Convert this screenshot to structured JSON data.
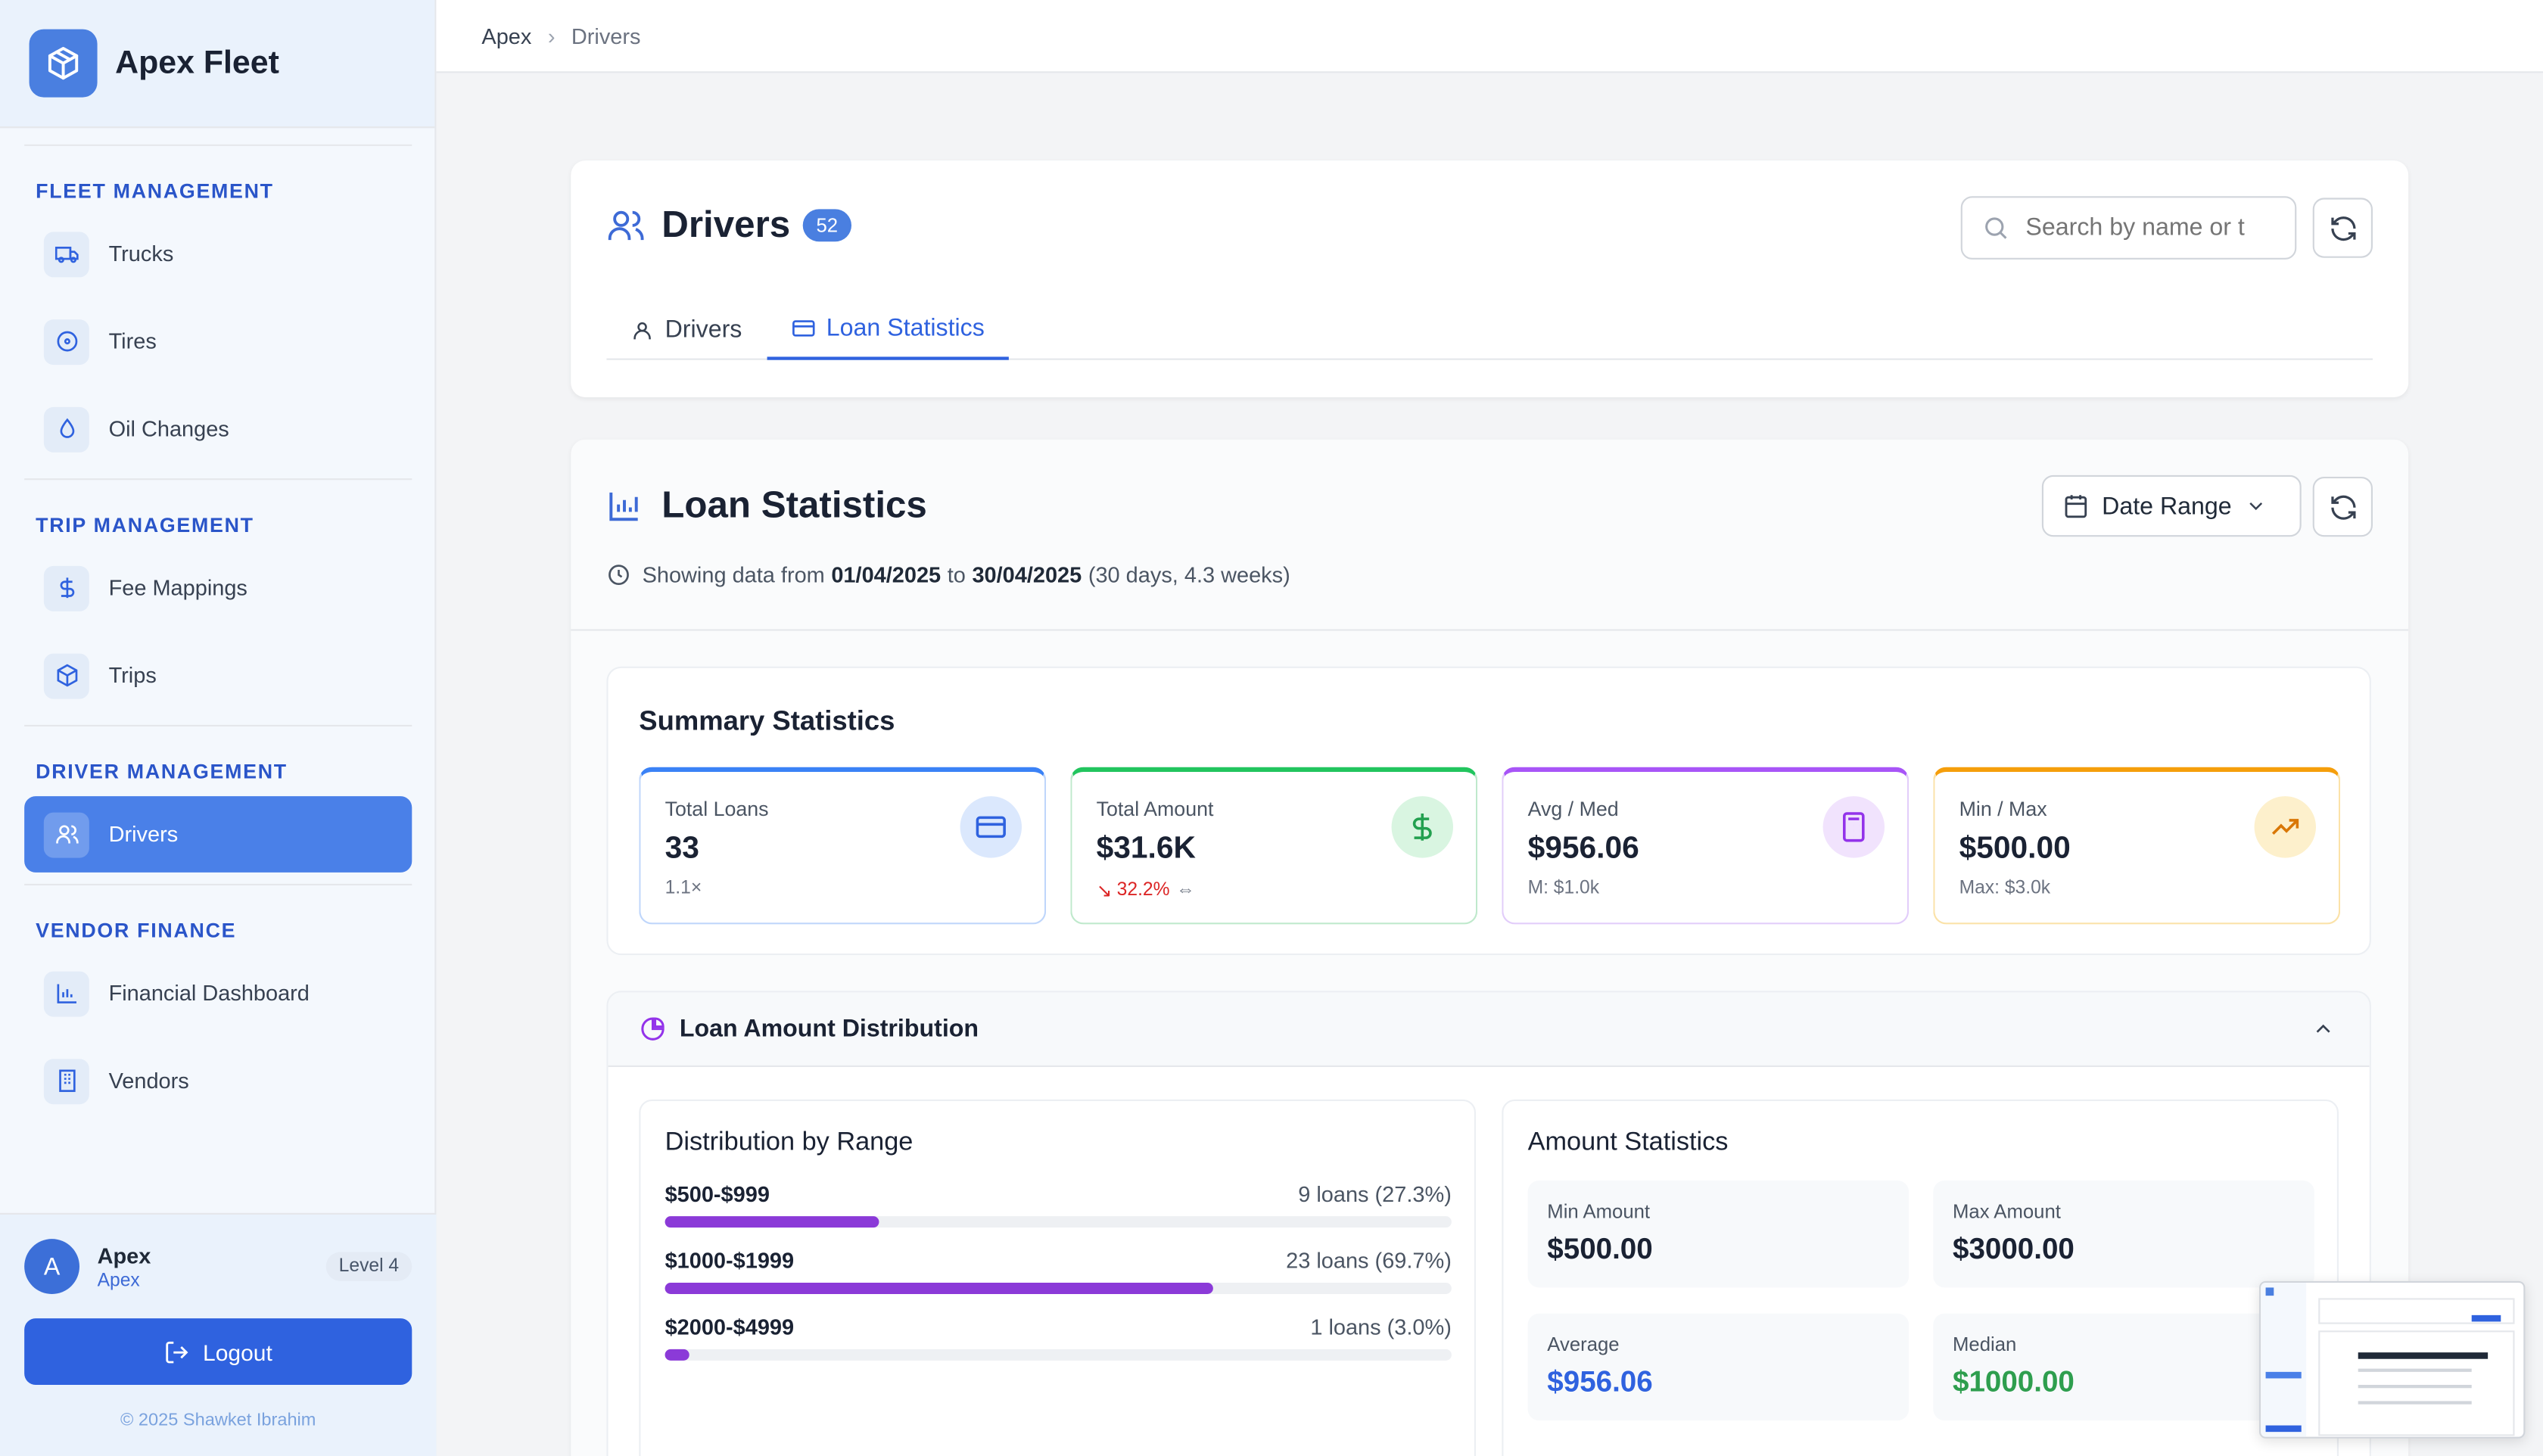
{
  "brand": {
    "name": "Apex Fleet"
  },
  "sidebar": {
    "sections": [
      {
        "title": "FLEET MANAGEMENT",
        "items": [
          "Trucks",
          "Tires",
          "Oil Changes"
        ]
      },
      {
        "title": "TRIP MANAGEMENT",
        "items": [
          "Fee Mappings",
          "Trips"
        ]
      },
      {
        "title": "DRIVER MANAGEMENT",
        "items": [
          "Drivers"
        ]
      },
      {
        "title": "VENDOR FINANCE",
        "items": [
          "Financial Dashboard",
          "Vendors"
        ]
      }
    ],
    "active_item": "Drivers"
  },
  "user": {
    "initial": "A",
    "name": "Apex",
    "org": "Apex",
    "level": "Level 4",
    "logout_label": "Logout",
    "copyright": "© 2025 Shawket Ibrahim"
  },
  "breadcrumb": {
    "root": "Apex",
    "current": "Drivers"
  },
  "header": {
    "title": "Drivers",
    "count": "52",
    "search_placeholder": "Search by name or t",
    "tabs": [
      "Drivers",
      "Loan Statistics"
    ],
    "active_tab": "Loan Statistics"
  },
  "loan_stats": {
    "title": "Loan Statistics",
    "date_button": "Date Range",
    "range_prefix": "Showing data from",
    "range_start": "01/04/2025",
    "range_to": "to",
    "range_end": "30/04/2025",
    "range_suffix": "(30 days, 4.3 weeks)",
    "summary_title": "Summary Statistics",
    "cards": [
      {
        "label": "Total Loans",
        "value": "33",
        "sub": "1.1×",
        "color": "#3b82f6"
      },
      {
        "label": "Total Amount",
        "value": "$31.6K",
        "sub": "32.2%",
        "color": "#22c55e"
      },
      {
        "label": "Avg / Med",
        "value": "$956.06",
        "sub": "M: $1.0k",
        "color": "#a855f7"
      },
      {
        "label": "Min / Max",
        "value": "$500.00",
        "sub": "Max: $3.0k",
        "color": "#f59e0b"
      }
    ],
    "distribution": {
      "title": "Loan Amount Distribution",
      "by_range_title": "Distribution by Range",
      "ranges": [
        {
          "label": "$500-$999",
          "count": "9 loans (27.3%)",
          "pct": 27.3
        },
        {
          "label": "$1000-$1999",
          "count": "23 loans (69.7%)",
          "pct": 69.7
        },
        {
          "label": "$2000-$4999",
          "count": "1 loans (3.0%)",
          "pct": 3.0
        }
      ],
      "amount_title": "Amount Statistics",
      "amounts": [
        {
          "label": "Min Amount",
          "value": "$500.00",
          "color": "#1a2233"
        },
        {
          "label": "Max Amount",
          "value": "$3000.00",
          "color": "#1a2233"
        },
        {
          "label": "Average",
          "value": "$956.06",
          "color": "#2f62df"
        },
        {
          "label": "Median",
          "value": "$1000.00",
          "color": "#2e9e4e"
        }
      ]
    }
  }
}
